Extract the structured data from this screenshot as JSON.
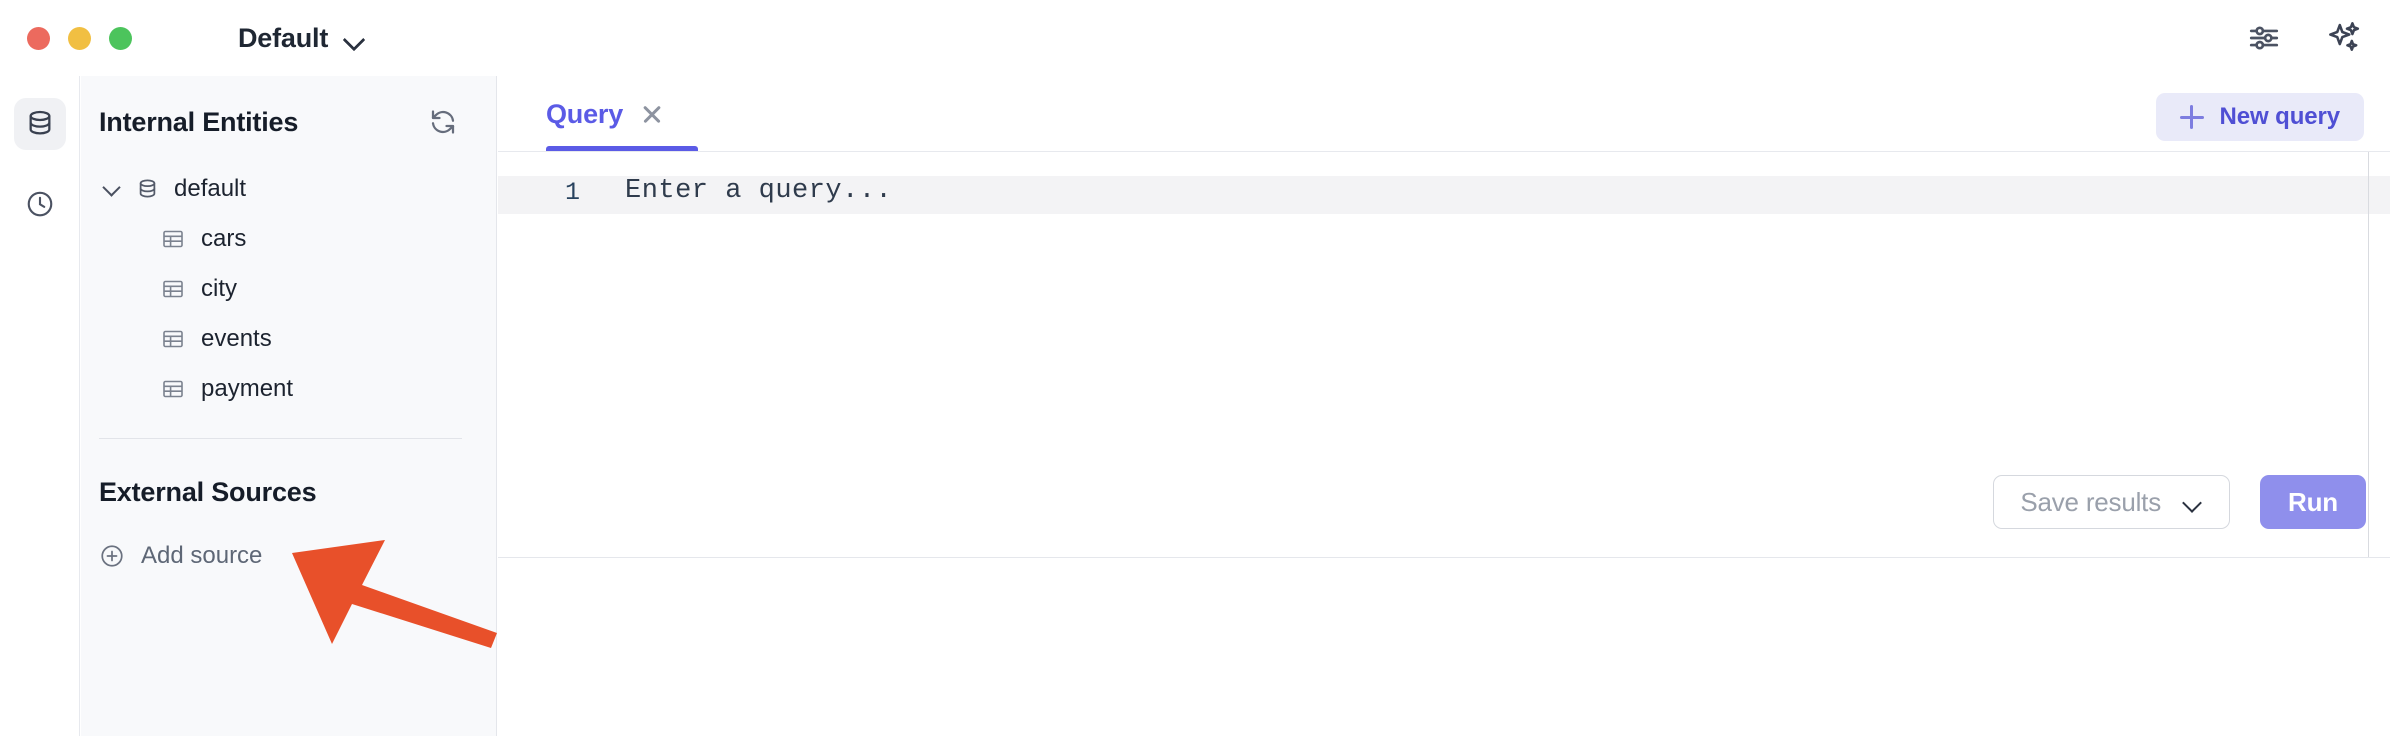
{
  "window": {
    "profile_name": "Default",
    "traffic_lights": [
      "close-red",
      "minimize-yellow",
      "maximize-green"
    ],
    "colors": {
      "accent_indigo": "#5b5be6",
      "run_button": "#8f8fec",
      "new_query_bg": "#e9eaf9",
      "sidebar_bg": "#f8f9fb",
      "annotation_arrow": "#e8502a"
    }
  },
  "titlebar_actions": [
    {
      "name": "settings-sliders-icon",
      "label": "Settings"
    },
    {
      "name": "ai-sparkles-icon",
      "label": "AI assistant"
    }
  ],
  "rail": {
    "items": [
      {
        "icon": "database-icon",
        "label": "Entities",
        "active": true
      },
      {
        "icon": "clock-history-icon",
        "label": "History",
        "active": false
      }
    ]
  },
  "sidebar": {
    "internal": {
      "title": "Internal Entities",
      "refresh_label": "Refresh",
      "database": {
        "name": "default",
        "expanded": true
      },
      "tables": [
        "cars",
        "city",
        "events",
        "payment"
      ]
    },
    "external": {
      "title": "External Sources",
      "add_source_label": "Add source"
    }
  },
  "main": {
    "tabs": [
      {
        "label": "Query",
        "active": true,
        "closable": true
      }
    ],
    "new_query_label": "New query",
    "editor": {
      "line_number": "1",
      "placeholder": "Enter a query...",
      "value": ""
    },
    "actions": {
      "save_results_label": "Save results",
      "run_label": "Run"
    }
  },
  "annotation": {
    "type": "arrow",
    "color": "#e8502a",
    "points_to": "Add source"
  }
}
